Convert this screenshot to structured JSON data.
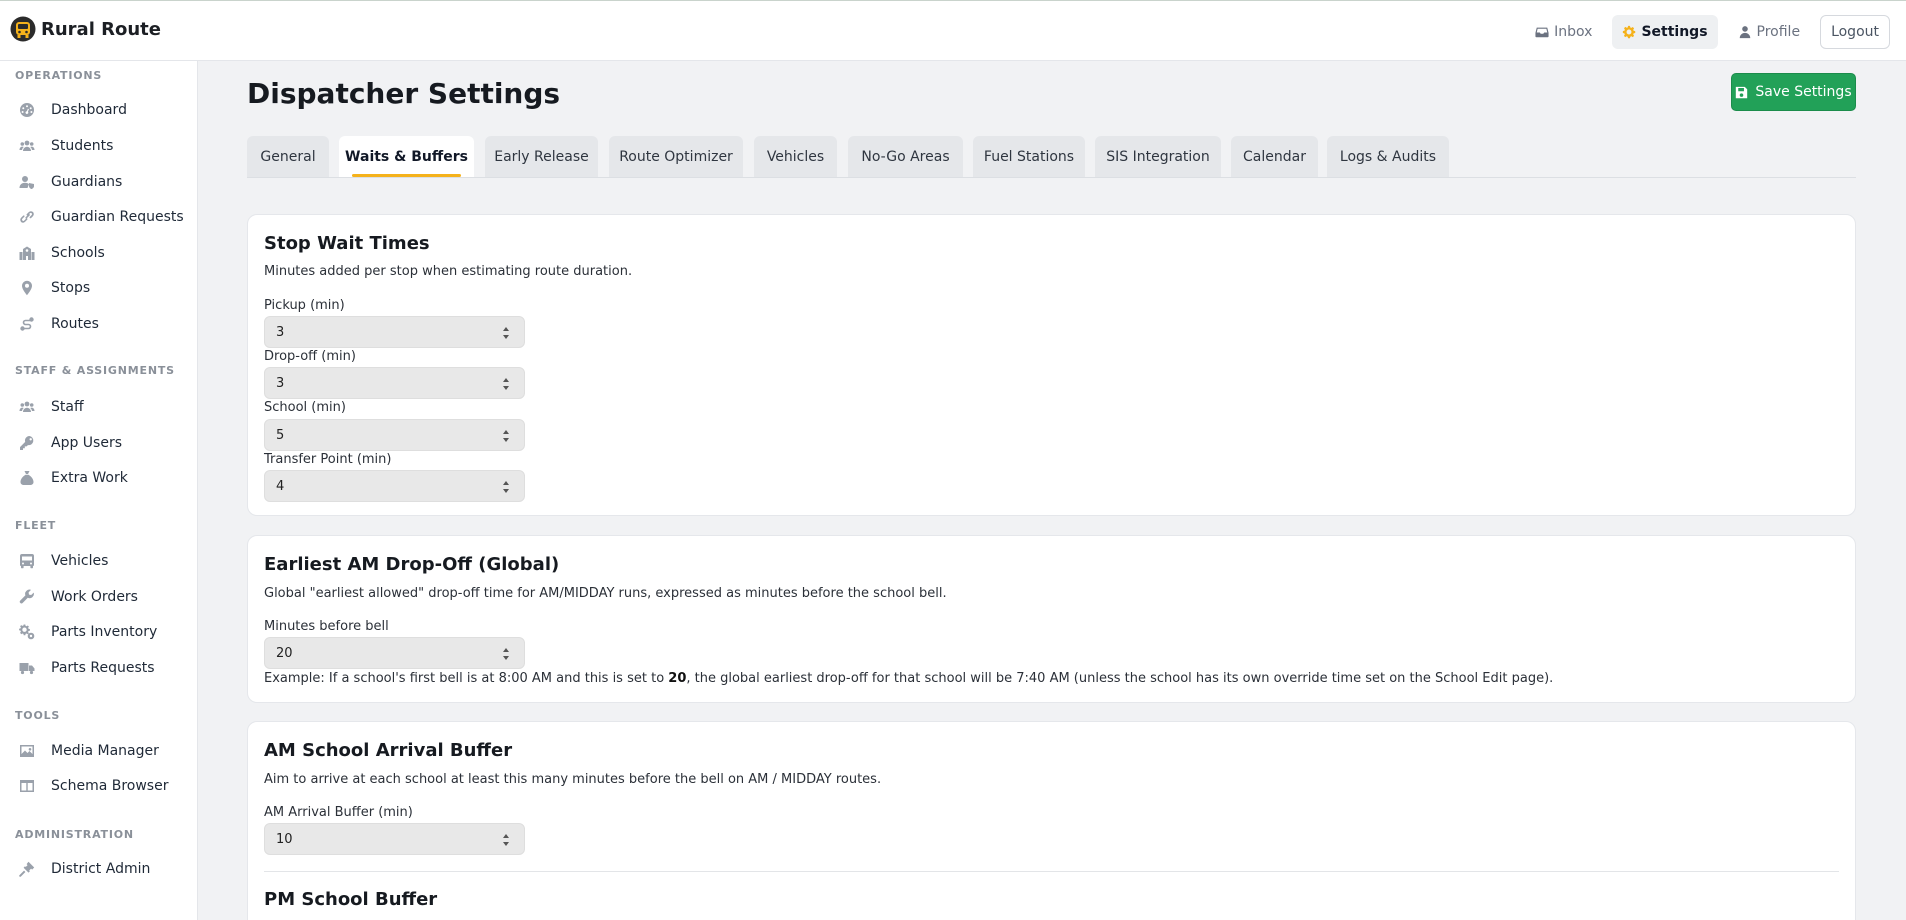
{
  "app": {
    "title": "Rural Route"
  },
  "topnav": {
    "inbox": "Inbox",
    "settings": "Settings",
    "profile": "Profile",
    "logout": "Logout"
  },
  "sidebar": {
    "sections": [
      {
        "title": "OPERATIONS",
        "items": [
          {
            "label": "Dashboard",
            "icon": "dashboard-icon"
          },
          {
            "label": "Students",
            "icon": "users-icon"
          },
          {
            "label": "Guardians",
            "icon": "guardian-icon"
          },
          {
            "label": "Guardian Requests",
            "icon": "link-icon"
          },
          {
            "label": "Schools",
            "icon": "school-icon"
          },
          {
            "label": "Stops",
            "icon": "map-pin-icon"
          },
          {
            "label": "Routes",
            "icon": "route-icon"
          }
        ]
      },
      {
        "title": "STAFF & ASSIGNMENTS",
        "items": [
          {
            "label": "Staff",
            "icon": "users-icon"
          },
          {
            "label": "App Users",
            "icon": "key-icon"
          },
          {
            "label": "Extra Work",
            "icon": "money-bag-icon"
          }
        ]
      },
      {
        "title": "FLEET",
        "items": [
          {
            "label": "Vehicles",
            "icon": "bus-icon"
          },
          {
            "label": "Work Orders",
            "icon": "wrench-icon"
          },
          {
            "label": "Parts Inventory",
            "icon": "gears-icon"
          },
          {
            "label": "Parts Requests",
            "icon": "truck-icon"
          }
        ]
      },
      {
        "title": "TOOLS",
        "items": [
          {
            "label": "Media Manager",
            "icon": "image-icon"
          },
          {
            "label": "Schema Browser",
            "icon": "table-icon"
          }
        ]
      },
      {
        "title": "ADMINISTRATION",
        "items": [
          {
            "label": "District Admin",
            "icon": "gavel-icon"
          }
        ]
      }
    ]
  },
  "main": {
    "title": "Dispatcher Settings",
    "save_label": "Save Settings",
    "tabs": [
      {
        "label": "General",
        "active": false
      },
      {
        "label": "Waits & Buffers",
        "active": true
      },
      {
        "label": "Early Release",
        "active": false
      },
      {
        "label": "Route Optimizer",
        "active": false
      },
      {
        "label": "Vehicles",
        "active": false
      },
      {
        "label": "No-Go Areas",
        "active": false
      },
      {
        "label": "Fuel Stations",
        "active": false
      },
      {
        "label": "SIS Integration",
        "active": false
      },
      {
        "label": "Calendar",
        "active": false
      },
      {
        "label": "Logs & Audits",
        "active": false
      }
    ],
    "stop_wait": {
      "title": "Stop Wait Times",
      "description": "Minutes added per stop when estimating route duration.",
      "fields": [
        {
          "label": "Pickup (min)",
          "value": "3"
        },
        {
          "label": "Drop-off (min)",
          "value": "3"
        },
        {
          "label": "School (min)",
          "value": "5"
        },
        {
          "label": "Transfer Point (min)",
          "value": "4"
        }
      ]
    },
    "earliest_dropoff": {
      "title": "Earliest AM Drop-Off (Global)",
      "description": "Global \"earliest allowed\" drop-off time for AM/MIDDAY runs, expressed as minutes before the school bell.",
      "field_label": "Minutes before bell",
      "value": "20",
      "example_prefix": "Example: If a school's first bell is at 8:00 AM and this is set to ",
      "example_value": "20",
      "example_suffix": ", the global earliest drop-off for that school will be 7:40 AM (unless the school has its own override time set on the School Edit page)."
    },
    "am_arrival": {
      "title": "AM School Arrival Buffer",
      "description": "Aim to arrive at each school at least this many minutes before the bell on AM / MIDDAY routes.",
      "field_label": "AM Arrival Buffer (min)",
      "value": "10"
    },
    "pm_buffer": {
      "title": "PM School Buffer"
    }
  },
  "colors": {
    "accent": "#f5b21b",
    "save_button": "#22a158"
  }
}
